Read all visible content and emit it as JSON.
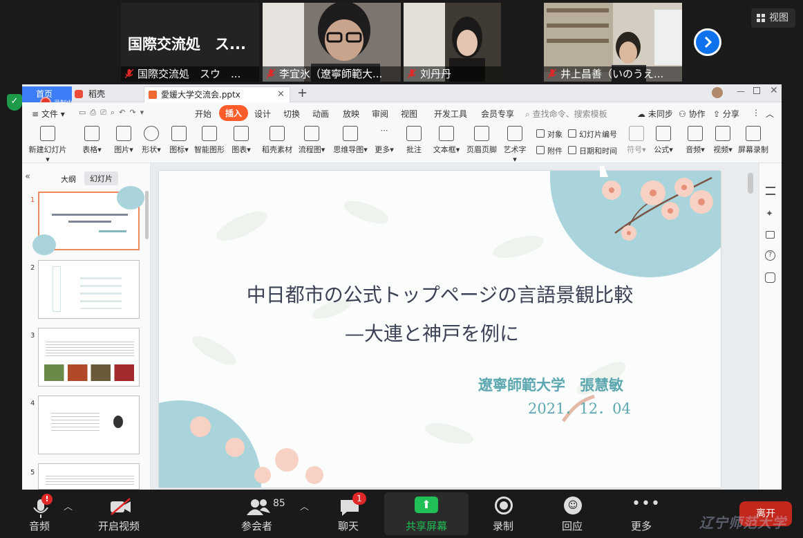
{
  "participants": [
    {
      "name": "国際交流処　スウ　...",
      "display_text": "国際交流処　ス..."
    },
    {
      "name": "李宜氷（遼寧師範大..."
    },
    {
      "name": "刘丹丹"
    },
    {
      "name": "井上昌善（いのうえ..."
    }
  ],
  "view_button": {
    "label": "视图"
  },
  "wps": {
    "tabs": {
      "home": "首页",
      "daoke": "稻壳",
      "file": "愛媛大学交流会.pptx",
      "recording": "录制中"
    },
    "menus": [
      "文件",
      "开始",
      "插入",
      "设计",
      "切换",
      "动画",
      "放映",
      "审阅",
      "视图",
      "开发工具",
      "会员专享"
    ],
    "search_placeholder": "查找命令、搜索模板",
    "right_actions": {
      "sync": "未同步",
      "collab": "协作",
      "share": "分享"
    },
    "ribbon": {
      "new_slide": "新建幻灯片",
      "table": "表格",
      "image": "图片",
      "shape": "形状",
      "icon": "图标",
      "smart": "智能图形",
      "chart": "图表",
      "daoke_material": "稻壳素材",
      "flowchart": "流程图",
      "mindmap": "思维导图",
      "more": "更多",
      "comment": "批注",
      "textbox": "文本框",
      "header_footer": "页眉页脚",
      "art_text": "艺术字",
      "object": "对象",
      "attachment": "附件",
      "slide_number": "幻灯片编号",
      "datetime": "日期和时间",
      "symbol": "符号",
      "formula": "公式",
      "audio": "音频",
      "video": "视频",
      "screen_record": "屏幕录制"
    },
    "panel_tabs": {
      "outline": "大纲",
      "slides": "幻灯片"
    },
    "thumb_numbers": [
      "1",
      "2",
      "3",
      "4",
      "5"
    ],
    "slide": {
      "title_line1": "中日都市の公式トップページの言語景観比較",
      "title_line2": "—大連と神戸を例に",
      "author": "遼寧師範大学　張慧敏",
      "date": "2021．12．04"
    }
  },
  "bottombar": {
    "audio": "音频",
    "video": "开启视频",
    "participants": "参会者",
    "participant_count": "85",
    "chat": "聊天",
    "chat_badge": "1",
    "share": "共享屏幕",
    "record": "录制",
    "reactions": "回应",
    "more": "更多",
    "leave": "离开",
    "audio_badge": "!"
  },
  "watermark": "辽宁师范大学",
  "colors": {
    "zoom_blue": "#0e72ed",
    "leave_red": "#c2281b",
    "share_green": "#1fbf55",
    "wps_insert_orange": "#ff5b2b",
    "slide_title": "#3b4255",
    "slide_author": "#5ca7b0",
    "slide_circle": "#a9d4dc"
  }
}
